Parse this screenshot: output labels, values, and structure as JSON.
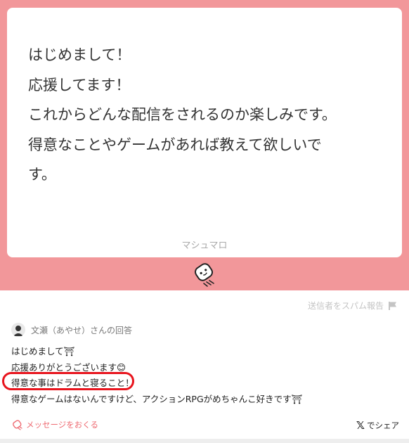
{
  "message": {
    "text": "はじめまして！\n応援してます！\nこれからどんな配信をされるのか楽しみです。\n得意なことやゲームがあれば教えて欲しいで\nす。",
    "brand": "マシュマロ"
  },
  "report": {
    "label": "送信者をスパム報告",
    "icon": "flag-icon"
  },
  "answer": {
    "answerer": "文瀬（あやせ）さんの回答",
    "lines": [
      "はじめまして⛩",
      "応援ありがとうございます😊",
      "得意な事はドラムと寝ること！",
      "得意なゲームはないんですけど、アクションRPGがめちゃんこ好きです⛩"
    ]
  },
  "footer": {
    "send_label": "メッセージをおくる",
    "share_label": "でシェア",
    "share_logo": "𝕏"
  },
  "colors": {
    "frame": "#f2979a",
    "accent": "#ee6b72",
    "highlight": "#e8141d"
  }
}
